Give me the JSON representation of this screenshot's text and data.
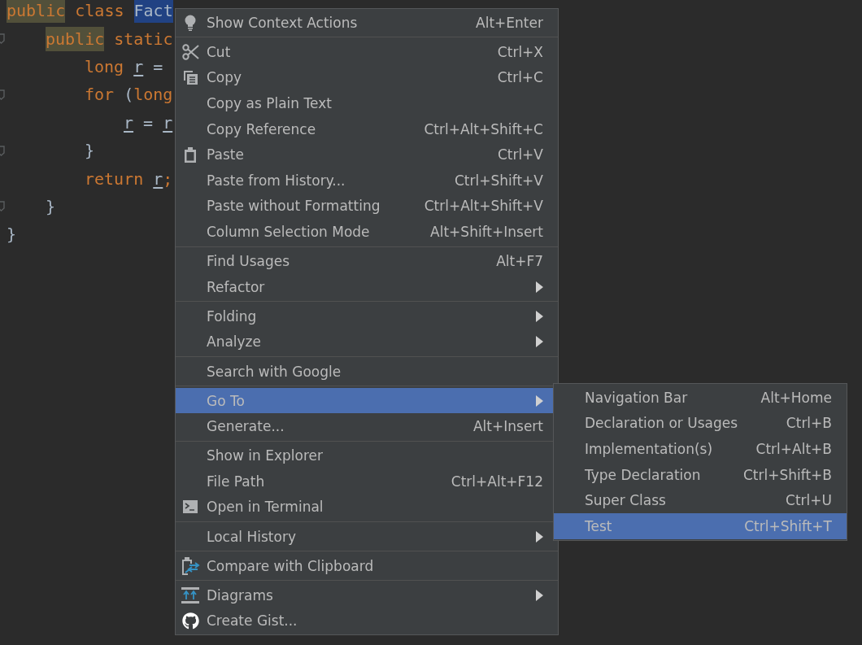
{
  "editor": {
    "lines": [
      {
        "fold_marker": false,
        "words": [
          [
            {
              "text": "public",
              "kind": "marked_keyword"
            }
          ],
          [
            {
              "text": "class",
              "kind": "keyword"
            }
          ],
          [
            {
              "text": "Fact",
              "kind": "selected"
            }
          ]
        ],
        "children": [
          {
            "fold_marker": true,
            "words": [
              [
                {
                  "text": "public",
                  "kind": "marked_keyword"
                }
              ],
              [
                {
                  "text": "static",
                  "kind": "keyword"
                }
              ]
            ],
            "children": [
              {
                "fold_marker": false,
                "words": [
                  [
                    {
                      "text": "long",
                      "kind": "keyword"
                    }
                  ],
                  [
                    {
                      "text": "r",
                      "kind": "variable"
                    }
                  ],
                  [
                    {
                      "text": "=",
                      "kind": "text"
                    }
                  ]
                ]
              },
              {
                "fold_marker": true,
                "words": [
                  [
                    {
                      "text": "for",
                      "kind": "keyword"
                    }
                  ],
                  [
                    {
                      "text": "(",
                      "kind": "text"
                    },
                    {
                      "text": "long",
                      "kind": "keyword"
                    }
                  ]
                ],
                "children": [
                  {
                    "fold_marker": false,
                    "words": [
                      [
                        {
                          "text": "r",
                          "kind": "variable"
                        }
                      ],
                      [
                        {
                          "text": "=",
                          "kind": "text"
                        }
                      ],
                      [
                        {
                          "text": "r",
                          "kind": "variable"
                        }
                      ]
                    ]
                  }
                ]
              },
              {
                "fold_marker": true,
                "words": [
                  [
                    {
                      "text": "}",
                      "kind": "text"
                    }
                  ]
                ]
              },
              {
                "fold_marker": false,
                "words": [
                  [
                    {
                      "text": "return",
                      "kind": "keyword"
                    }
                  ],
                  [
                    {
                      "text": "r",
                      "kind": "variable"
                    },
                    {
                      "text": ";",
                      "kind": "keyword"
                    }
                  ]
                ]
              }
            ]
          },
          {
            "fold_marker": true,
            "words": [
              [
                {
                  "text": "}",
                  "kind": "text"
                }
              ]
            ]
          }
        ]
      },
      {
        "fold_marker": false,
        "words": [
          [
            {
              "text": "}",
              "kind": "text"
            }
          ]
        ]
      }
    ]
  },
  "context_menu": {
    "groups": [
      {
        "items": [
          {
            "label": "Show Context Actions",
            "shortcut": "Alt+Enter",
            "kind": "bulb",
            "selected": false,
            "has_submenu": false
          }
        ]
      },
      {
        "items": [
          {
            "label": "Cut",
            "shortcut": "Ctrl+X",
            "kind": "scissors",
            "selected": false,
            "has_submenu": false
          },
          {
            "label": "Copy",
            "shortcut": "Ctrl+C",
            "kind": "copy",
            "selected": false,
            "has_submenu": false
          },
          {
            "label": "Copy as Plain Text",
            "selected": false,
            "has_submenu": false
          },
          {
            "label": "Copy Reference",
            "shortcut": "Ctrl+Alt+Shift+C",
            "selected": false,
            "has_submenu": false
          },
          {
            "label": "Paste",
            "shortcut": "Ctrl+V",
            "kind": "clipboard",
            "selected": false,
            "has_submenu": false
          },
          {
            "label": "Paste from History...",
            "shortcut": "Ctrl+Shift+V",
            "selected": false,
            "has_submenu": false
          },
          {
            "label": "Paste without Formatting",
            "shortcut": "Ctrl+Alt+Shift+V",
            "selected": false,
            "has_submenu": false
          },
          {
            "label": "Column Selection Mode",
            "shortcut": "Alt+Shift+Insert",
            "selected": false,
            "has_submenu": false
          }
        ]
      },
      {
        "items": [
          {
            "label": "Find Usages",
            "shortcut": "Alt+F7",
            "selected": false,
            "has_submenu": false
          },
          {
            "label": "Refactor",
            "selected": false,
            "has_submenu": true
          }
        ]
      },
      {
        "items": [
          {
            "label": "Folding",
            "selected": false,
            "has_submenu": true
          },
          {
            "label": "Analyze",
            "selected": false,
            "has_submenu": true
          }
        ]
      },
      {
        "items": [
          {
            "label": "Search with Google",
            "selected": false,
            "has_submenu": false
          }
        ]
      },
      {
        "items": [
          {
            "label": "Go To",
            "selected": true,
            "has_submenu": true,
            "submenu": {
              "items": [
                {
                  "label": "Navigation Bar",
                  "shortcut": "Alt+Home",
                  "selected": false
                },
                {
                  "label": "Declaration or Usages",
                  "shortcut": "Ctrl+B",
                  "selected": false
                },
                {
                  "label": "Implementation(s)",
                  "shortcut": "Ctrl+Alt+B",
                  "selected": false
                },
                {
                  "label": "Type Declaration",
                  "shortcut": "Ctrl+Shift+B",
                  "selected": false
                },
                {
                  "label": "Super Class",
                  "shortcut": "Ctrl+U",
                  "selected": false
                },
                {
                  "label": "Test",
                  "shortcut": "Ctrl+Shift+T",
                  "selected": true
                }
              ]
            }
          },
          {
            "label": "Generate...",
            "shortcut": "Alt+Insert",
            "selected": false,
            "has_submenu": false
          }
        ]
      },
      {
        "items": [
          {
            "label": "Show in Explorer",
            "selected": false,
            "has_submenu": false
          },
          {
            "label": "File Path",
            "shortcut": "Ctrl+Alt+F12",
            "selected": false,
            "has_submenu": false
          },
          {
            "label": "Open in Terminal",
            "kind": "terminal",
            "selected": false,
            "has_submenu": false
          }
        ]
      },
      {
        "items": [
          {
            "label": "Local History",
            "selected": false,
            "has_submenu": true
          }
        ]
      },
      {
        "items": [
          {
            "label": "Compare with Clipboard",
            "kind": "compare",
            "selected": false,
            "has_submenu": false
          }
        ]
      },
      {
        "items": [
          {
            "label": "Diagrams",
            "kind": "diagrams",
            "selected": false,
            "has_submenu": true
          },
          {
            "label": "Create Gist...",
            "kind": "github",
            "selected": false,
            "has_submenu": false
          }
        ]
      }
    ]
  }
}
